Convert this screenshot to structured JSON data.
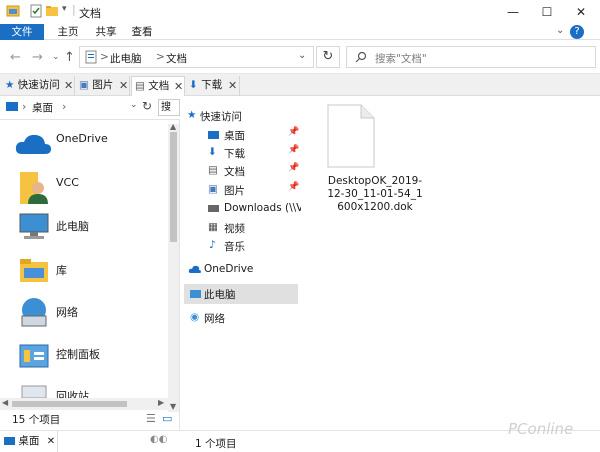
{
  "window": {
    "title": "文档",
    "minimize": "—",
    "maximize": "☐",
    "close": "✕"
  },
  "ribbon": {
    "tabs": [
      "文件",
      "主页",
      "共享",
      "查看"
    ],
    "help": "?"
  },
  "address": {
    "crumbs": [
      "此电脑",
      "文档"
    ],
    "separator": ">",
    "search_placeholder": "搜索\"文档\""
  },
  "tabs": [
    {
      "label": "快速访问"
    },
    {
      "label": "图片"
    },
    {
      "label": "文档",
      "active": true
    },
    {
      "label": "下载"
    }
  ],
  "left_pane": {
    "crumb": "桌面",
    "search_btn": "搜",
    "items": [
      "OneDrive",
      "VCC",
      "此电脑",
      "库",
      "网络",
      "控制面板",
      "回收站"
    ],
    "status": "15 个项目"
  },
  "nav_pane": {
    "quick_access": "快速访问",
    "pinned": [
      "桌面",
      "下载",
      "文档",
      "图片"
    ],
    "others": [
      "Downloads (\\\\VB",
      "视频",
      "音乐"
    ],
    "onedrive": "OneDrive",
    "this_pc": "此电脑",
    "network": "网络"
  },
  "content": {
    "file_name": "DesktopOK_2019-12-30_11-01-54_1600x1200.dok"
  },
  "status": {
    "count": "1 个项目"
  },
  "bottom_tab": {
    "label": "桌面"
  },
  "watermark": "PConline",
  "colors": {
    "accent": "#1a6fc4",
    "selection": "#e0e0e0"
  }
}
